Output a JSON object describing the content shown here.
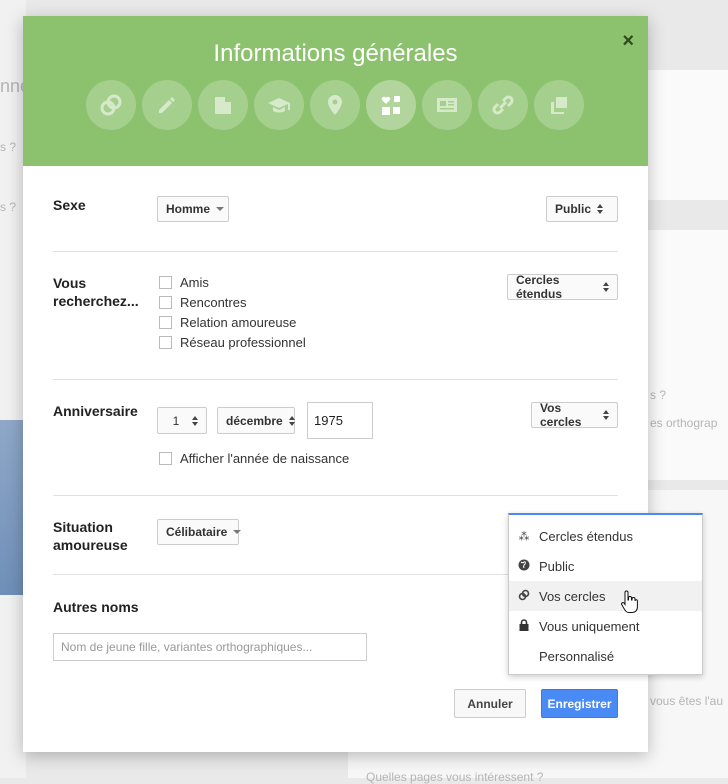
{
  "background": {
    "texts": [
      "nne",
      "s ?",
      "s ?",
      "s ?",
      "es orthograp",
      "vous êtes l'au",
      "Quelles pages vous intéressent ?"
    ]
  },
  "dialog": {
    "title": "Informations générales",
    "close_label": "×",
    "icon_tabs": [
      "link-icon",
      "pencil-icon",
      "building-icon",
      "graduation-cap-icon",
      "map-pin-icon",
      "relationship-icon",
      "id-card-icon",
      "chain-icon",
      "pages-icon"
    ],
    "sexe": {
      "label": "Sexe",
      "value": "Homme",
      "visibility": "Public"
    },
    "recherche": {
      "label": "Vous recherchez...",
      "options": [
        "Amis",
        "Rencontres",
        "Relation amoureuse",
        "Réseau professionnel"
      ],
      "visibility": "Cercles étendus"
    },
    "anniversaire": {
      "label": "Anniversaire",
      "day": "1",
      "month": "décembre",
      "year": "1975",
      "show_year_label": "Afficher l'année de naissance",
      "visibility": "Vos cercles"
    },
    "situation": {
      "label": "Situation amoureuse",
      "value": "Célibataire"
    },
    "autres_noms": {
      "label": "Autres noms",
      "placeholder": "Nom de jeune fille, variantes orthographiques..."
    },
    "buttons": {
      "cancel": "Annuler",
      "save": "Enregistrer"
    }
  },
  "visibility_menu": {
    "items": [
      {
        "label": "Cercles étendus",
        "icon": "extended-circles-icon"
      },
      {
        "label": "Public",
        "icon": "globe-icon"
      },
      {
        "label": "Vos cercles",
        "icon": "circles-icon",
        "highlighted": true
      },
      {
        "label": "Vous uniquement",
        "icon": "lock-icon"
      },
      {
        "label": "Personnalisé",
        "icon": ""
      }
    ]
  },
  "colors": {
    "header": "#8cc26e",
    "primary": "#4a8af4"
  }
}
